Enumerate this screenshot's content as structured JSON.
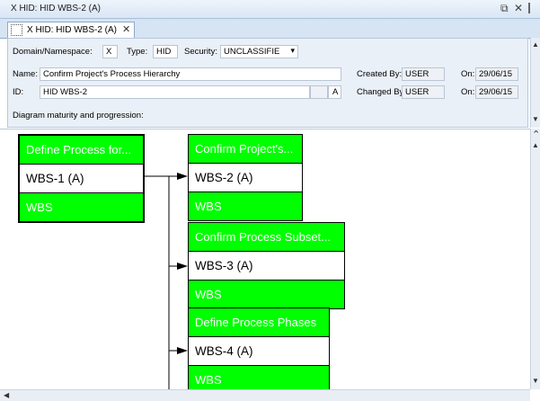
{
  "window": {
    "title": "X HID: HID WBS-2 (A)",
    "restore_glyph": "⧉",
    "close_glyph": "✕"
  },
  "tab": {
    "label": "X HID: HID WBS-2 (A)",
    "close_glyph": "✕"
  },
  "properties": {
    "domain_label": "Domain/Namespace:",
    "domain_value": "X",
    "type_label": "Type:",
    "type_value": "HID",
    "security_label": "Security:",
    "security_value": "UNCLASSIFIE",
    "security_arrow": "▾",
    "name_label": "Name:",
    "name_value": "Confirm Project's Process Hierarchy",
    "id_label": "ID:",
    "id_value": "HID WBS-2",
    "id_version": "A",
    "created_by_label": "Created By:",
    "created_by_value": "USER",
    "created_on_label": "On:",
    "created_on_value": "29/06/15",
    "changed_by_label": "Changed By:",
    "changed_by_value": "USER",
    "changed_on_label": "On:",
    "changed_on_value": "29/06/15",
    "description": "Diagram maturity and progression:"
  },
  "diagram": {
    "nodes": [
      {
        "title": "Define Process for...",
        "id": "WBS-1 (A)",
        "type": "WBS"
      },
      {
        "title": "Confirm Project's...",
        "id": "WBS-2 (A)",
        "type": "WBS"
      },
      {
        "title": "Confirm Process Subset...",
        "id": "WBS-3 (A)",
        "type": "WBS"
      },
      {
        "title": "Define Process Phases",
        "id": "WBS-4 (A)",
        "type": "WBS"
      }
    ]
  },
  "colors": {
    "node_fill": "#00ff00",
    "node_text": "#ffffff",
    "connector": "#000000"
  },
  "scroll_glyphs": {
    "up": "▲",
    "down": "▼",
    "left": "◀",
    "up_chevron": "⌃"
  }
}
